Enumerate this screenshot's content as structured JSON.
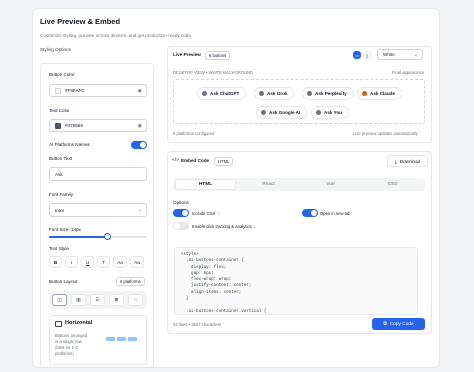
{
  "page": {
    "title": "Live Preview & Embed",
    "subtitle": "Customize styling, preview across devices, and get production-ready code.",
    "styling_section": "Styling Options"
  },
  "styling": {
    "button_color_label": "Button Color",
    "button_color_value": "#F8FAFC",
    "button_color_swatch": "#F8FAFC",
    "text_color_label": "Text Color",
    "text_color_value": "#475569",
    "text_color_swatch": "#475569",
    "ai_names_label": "AI Platforms Names",
    "button_text_label": "Button Text",
    "button_text_value": "Ask",
    "font_family_label": "Font Family",
    "font_family_value": "Inter",
    "font_size_label": "Font Size: 14px",
    "font_size_fraction": 0.6,
    "text_style_label": "Text Style",
    "text_style_buttons": [
      "B",
      "I",
      "U",
      "T",
      "Aa",
      "Aa"
    ],
    "button_layout_label": "Button Layout",
    "button_layout_badge": "6 platforms",
    "layout_icons": [
      "grid-icon",
      "columns-icon",
      "list-icon",
      "grid-small-icon",
      "apps-icon"
    ],
    "layout_title": "Horizontal",
    "layout_desc": [
      "Buttons arranged",
      "in a single row",
      "(best for 1-3",
      "platforms)"
    ]
  },
  "preview": {
    "title": "Live Preview",
    "badge": "6 buttons",
    "theme_select": "White",
    "view_label": "DESKTOP VIEW • WHITE BACKGROUND",
    "view_right": "Final appearance",
    "buttons": [
      {
        "label": "Ask ChatGPT",
        "color": "#6b7280"
      },
      {
        "label": "Ask Grok",
        "color": "#6b7280"
      },
      {
        "label": "Ask Perplexity",
        "color": "#6b7280"
      },
      {
        "label": "Ask Claude",
        "color": "#ea580c"
      },
      {
        "label": "Ask Google AI",
        "color": "#6b7280"
      },
      {
        "label": "Ask You",
        "color": "#6b7280"
      }
    ],
    "footer_left": "6 platforms configured",
    "footer_right": "Live preview updates automatically"
  },
  "embed": {
    "title": "Embed Code",
    "badge": "HTML",
    "download": "Download",
    "tabs": [
      "HTML",
      "React",
      "Vue",
      "CSS"
    ],
    "options_label": "Options",
    "include_css": "Include CSS",
    "open_new_tab": "Open in new tab",
    "tracking": "Enable click tracking & analytics",
    "code": "<style>\n  .ai-buttons-container {\n    display: flex;\n    gap: 8px;\n    flex-wrap: wrap;\n    justify-content: center;\n    align-items: center;\n  }\n\n  .ai-buttons-container.vertical {\n    flex-direction: column;",
    "stats": "54 lines • 3827 characters",
    "copy_button": "Copy Code"
  }
}
